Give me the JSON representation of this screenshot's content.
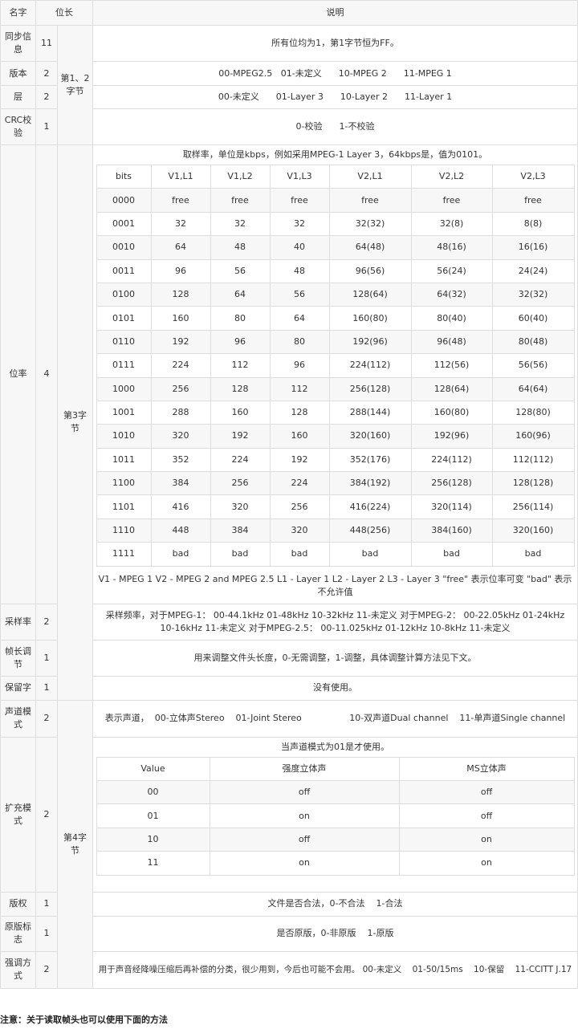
{
  "headers": {
    "name": "名字",
    "bits": "位长",
    "desc": "说明"
  },
  "positions": {
    "b12": "第1、2字节",
    "b3": "第3字节",
    "b4": "第4字节"
  },
  "rows": {
    "sync": {
      "name": "同步信息",
      "bits": "11",
      "desc": "所有位均为1，第1字节恒为FF。"
    },
    "version": {
      "name": "版本",
      "bits": "2",
      "desc": "00-MPEG2.5   01-未定义      10-MPEG 2      11-MPEG 1"
    },
    "layer": {
      "name": "层",
      "bits": "2",
      "desc": "00-未定义      01-Layer 3      10-Layer 2      11-Layer 1"
    },
    "crc": {
      "name": "CRC校验",
      "bits": "1",
      "desc": "0-校验      1-不校验"
    },
    "bitrate": {
      "name": "位率",
      "bits": "4",
      "caption": "取样率，单位是kbps，例如采用MPEG-1 Layer 3，64kbps是，值为0101。",
      "footer": "V1 - MPEG 1        V2 - MPEG 2 and MPEG 2.5 L1 - Layer 1        L2 - Layer 2        L3 - Layer 3 \"free\" 表示位率可变        \"bad\" 表示不允许值"
    },
    "samplerate": {
      "name": "采样率",
      "bits": "2",
      "desc": "采样频率，对于MPEG-1：  00-44.1kHz    01-48kHz    10-32kHz    11-未定义 对于MPEG-2：  00-22.05kHz    01-24kHz    10-16kHz    11-未定义 对于MPEG-2.5：  00-11.025kHz    01-12kHz    10-8kHz    11-未定义"
    },
    "padding": {
      "name": "帧长调节",
      "bits": "1",
      "desc": "用来调整文件头长度，0-无需调整，1-调整，具体调整计算方法见下文。"
    },
    "reserved": {
      "name": "保留字",
      "bits": "1",
      "desc": "没有使用。"
    },
    "channel": {
      "name": "声道模式",
      "bits": "2",
      "desc": "表示声道，  00-立体声Stereo    01-Joint Stereo                 10-双声道Dual channel    11-单声道Single channel"
    },
    "modeext": {
      "name": "扩充模式",
      "bits": "2",
      "caption": "当声道模式为01是才使用。"
    },
    "copyright": {
      "name": "版权",
      "bits": "1",
      "desc": "文件是否合法，0-不合法    1-合法"
    },
    "original": {
      "name": "原版标志",
      "bits": "1",
      "desc": "是否原版，0-非原版    1-原版"
    },
    "emphasis": {
      "name": "强调方式",
      "bits": "2",
      "desc": "用于声音经降噪压缩后再补偿的分类，很少用到，今后也可能不会用。 00-未定义    01-50/15ms    10-保留    11-CCITT J.17"
    }
  },
  "bitrate_table": {
    "header": [
      "bits",
      "V1,L1",
      "V1,L2",
      "V1,L3",
      "V2,L1",
      "V2,L2",
      "V2,L3"
    ],
    "rows": [
      [
        "0000",
        "free",
        "free",
        "free",
        "free",
        "free",
        "free"
      ],
      [
        "0001",
        "32",
        "32",
        "32",
        "32(32)",
        "32(8)",
        "8(8)"
      ],
      [
        "0010",
        "64",
        "48",
        "40",
        "64(48)",
        "48(16)",
        "16(16)"
      ],
      [
        "0011",
        "96",
        "56",
        "48",
        "96(56)",
        "56(24)",
        "24(24)"
      ],
      [
        "0100",
        "128",
        "64",
        "56",
        "128(64)",
        "64(32)",
        "32(32)"
      ],
      [
        "0101",
        "160",
        "80",
        "64",
        "160(80)",
        "80(40)",
        "60(40)"
      ],
      [
        "0110",
        "192",
        "96",
        "80",
        "192(96)",
        "96(48)",
        "80(48)"
      ],
      [
        "0111",
        "224",
        "112",
        "96",
        "224(112)",
        "112(56)",
        "56(56)"
      ],
      [
        "1000",
        "256",
        "128",
        "112",
        "256(128)",
        "128(64)",
        "64(64)"
      ],
      [
        "1001",
        "288",
        "160",
        "128",
        "288(144)",
        "160(80)",
        "128(80)"
      ],
      [
        "1010",
        "320",
        "192",
        "160",
        "320(160)",
        "192(96)",
        "160(96)"
      ],
      [
        "1011",
        "352",
        "224",
        "192",
        "352(176)",
        "224(112)",
        "112(112)"
      ],
      [
        "1100",
        "384",
        "256",
        "224",
        "384(192)",
        "256(128)",
        "128(128)"
      ],
      [
        "1101",
        "416",
        "320",
        "256",
        "416(224)",
        "320(114)",
        "256(114)"
      ],
      [
        "1110",
        "448",
        "384",
        "320",
        "448(256)",
        "384(160)",
        "320(160)"
      ],
      [
        "1111",
        "bad",
        "bad",
        "bad",
        "bad",
        "bad",
        "bad"
      ]
    ]
  },
  "modeext_table": {
    "header": [
      "Value",
      "强度立体声",
      "MS立体声"
    ],
    "rows": [
      [
        "00",
        "off",
        "off"
      ],
      [
        "01",
        "on",
        "off"
      ],
      [
        "10",
        "off",
        "on"
      ],
      [
        "11",
        "on",
        "on"
      ]
    ]
  },
  "note": "注意：关于读取帧头也可以使用下面的方法"
}
